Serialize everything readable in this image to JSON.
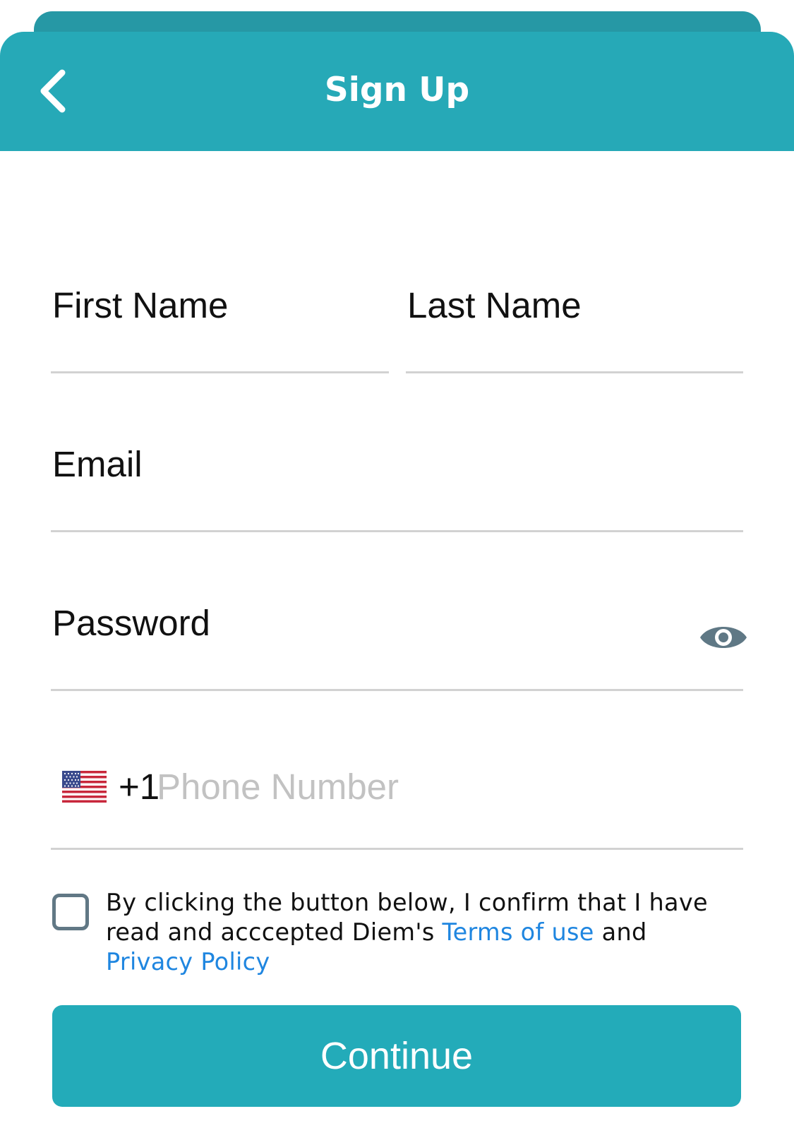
{
  "header": {
    "title": "Sign Up",
    "back_icon": "chevron-left-icon"
  },
  "form": {
    "first_name_label": "First Name",
    "last_name_label": "Last Name",
    "email_label": "Email",
    "password_label": "Password",
    "password_toggle_icon": "eye-icon",
    "phone": {
      "country_flag": "us-flag-icon",
      "country_code": "+1",
      "placeholder": "Phone Number"
    }
  },
  "consent": {
    "text_before": "By clicking the button below, I confirm that I have read and acccepted Diem's ",
    "terms_link": "Terms of use",
    "text_middle": " and ",
    "privacy_link": "Privacy Policy",
    "checked": false
  },
  "continue_button": {
    "label": "Continue"
  },
  "colors": {
    "header_background": "#26a9b7",
    "header_back_card": "#2698a5",
    "button_background": "#23abb9",
    "link": "#1f86e0",
    "placeholder": "#c2c2c2",
    "underline": "#d2d2d2",
    "checkbox_border": "#617885",
    "eye_icon": "#5f7885"
  }
}
